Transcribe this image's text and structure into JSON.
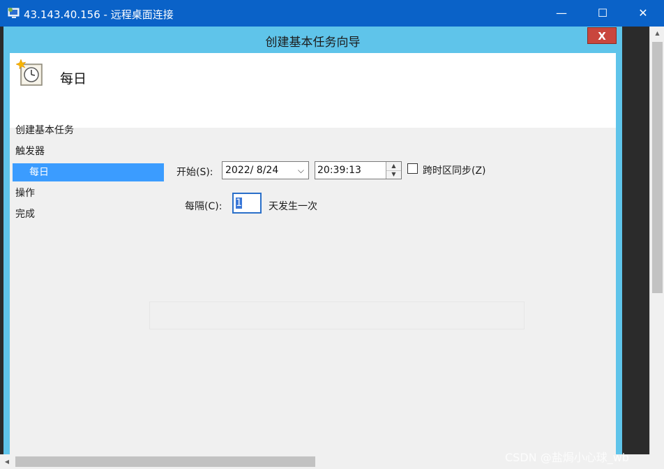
{
  "rdp_window": {
    "title": "43.143.40.156 - 远程桌面连接",
    "minimize": "—",
    "maximize": "☐",
    "close": "✕"
  },
  "dialog": {
    "title": "创建基本任务向导",
    "close": "X",
    "header_title": "每日",
    "steps": [
      {
        "label": "创建基本任务",
        "active": false
      },
      {
        "label": "触发器",
        "active": false
      },
      {
        "label": "每日",
        "active": true
      },
      {
        "label": "操作",
        "active": false
      },
      {
        "label": "完成",
        "active": false
      }
    ],
    "start_label": "开始(S):",
    "date_value": "2022/  8/24",
    "time_value": "20:39:13",
    "sync_timezone_label": "跨时区同步(Z)",
    "sync_timezone_checked": false,
    "recur_label": "每隔(C):",
    "recur_value": "1",
    "recur_suffix": "天发生一次"
  },
  "watermark": "CSDN @盐焗小心球_wb",
  "colors": {
    "rdp_titlebar": "#0a62c8",
    "dialog_frame": "#5fc4ea",
    "dialog_close": "#c9463d",
    "active_step": "#3b9cff"
  }
}
